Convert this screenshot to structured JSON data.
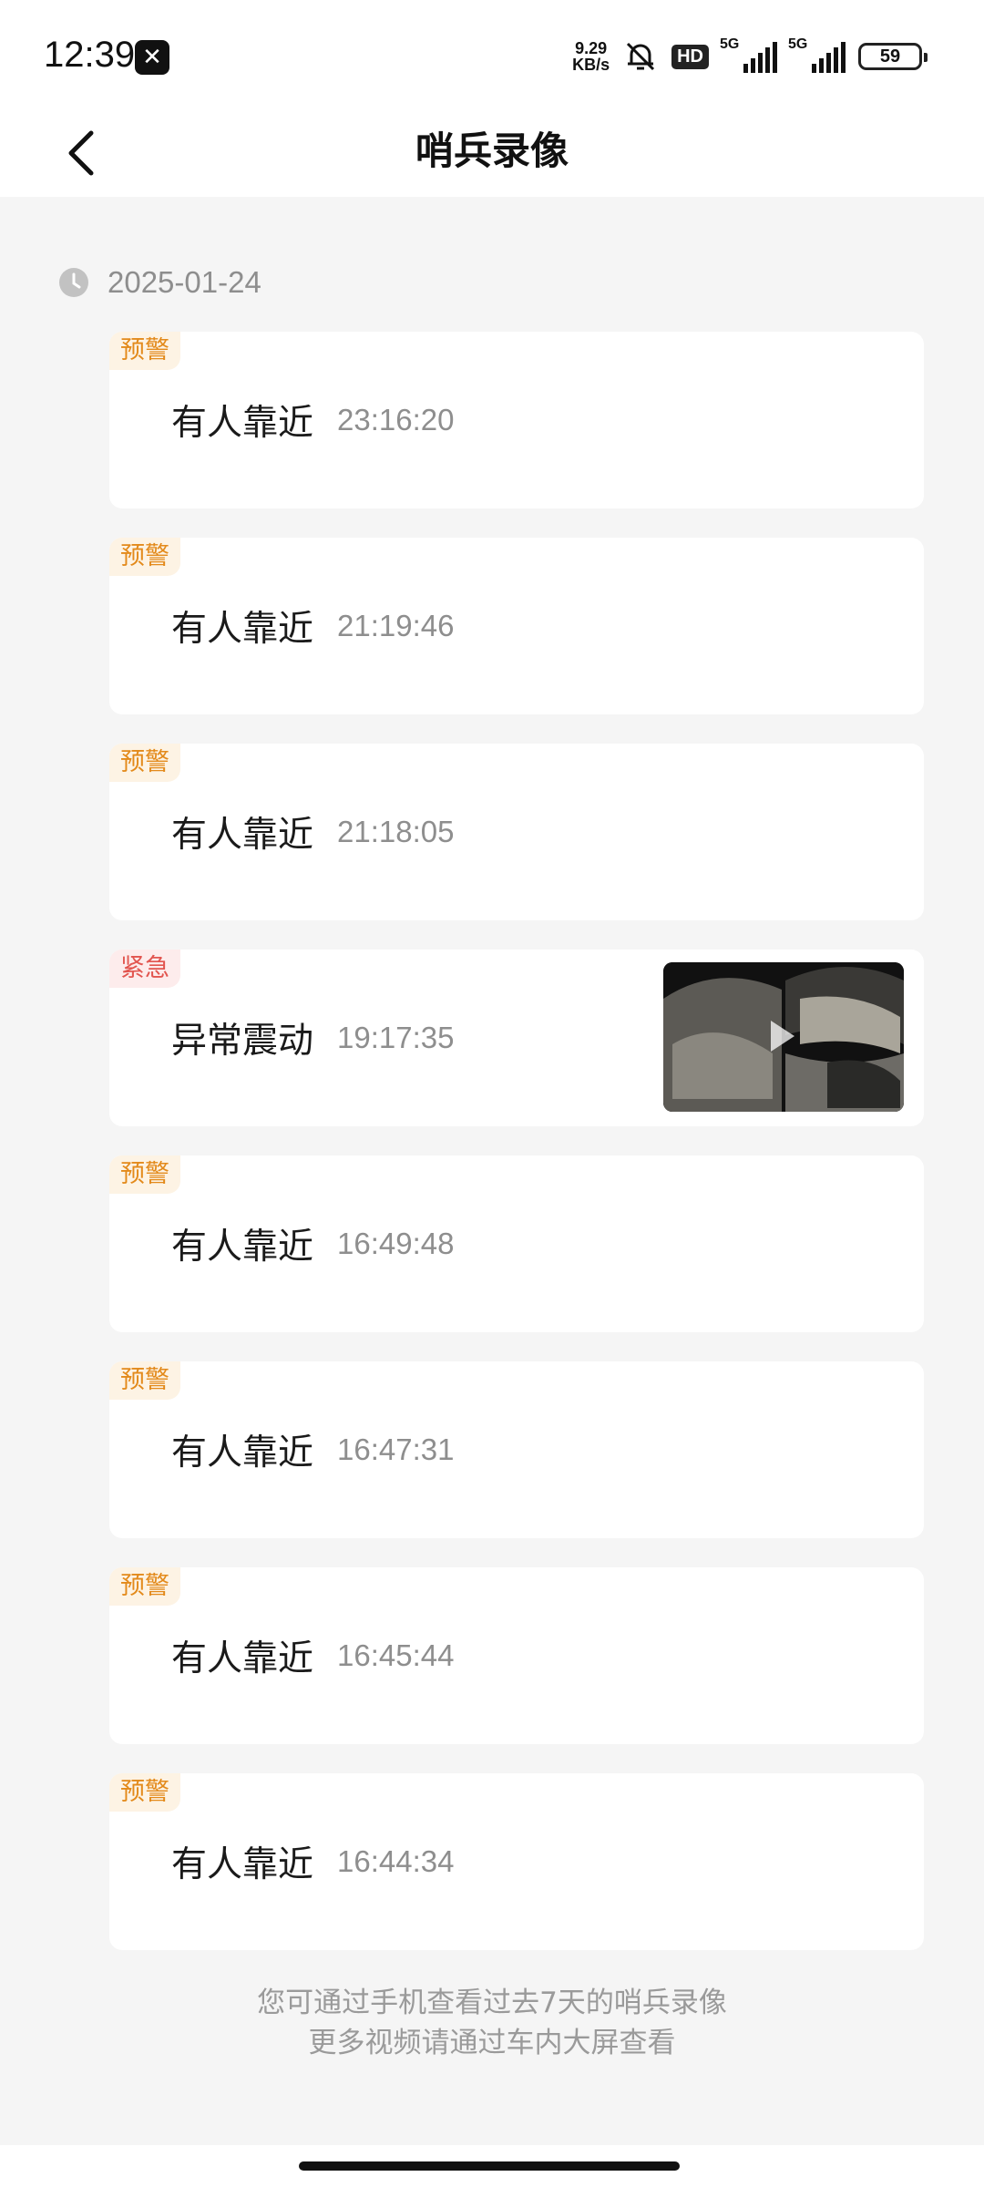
{
  "status_bar": {
    "time": "12:39",
    "net_speed_value": "9.29",
    "net_speed_unit": "KB/s",
    "hd_label": "HD",
    "sim1_label": "5G",
    "sim2_label": "5G",
    "battery": "59"
  },
  "header": {
    "title": "哨兵录像"
  },
  "date_group": {
    "date": "2025-01-24"
  },
  "events": [
    {
      "badge": "预警",
      "level": "warn",
      "name": "有人靠近",
      "time": "23:16:20",
      "has_thumbnail": false
    },
    {
      "badge": "预警",
      "level": "warn",
      "name": "有人靠近",
      "time": "21:19:46",
      "has_thumbnail": false
    },
    {
      "badge": "预警",
      "level": "warn",
      "name": "有人靠近",
      "time": "21:18:05",
      "has_thumbnail": false
    },
    {
      "badge": "紧急",
      "level": "urgent",
      "name": "异常震动",
      "time": "19:17:35",
      "has_thumbnail": true
    },
    {
      "badge": "预警",
      "level": "warn",
      "name": "有人靠近",
      "time": "16:49:48",
      "has_thumbnail": false
    },
    {
      "badge": "预警",
      "level": "warn",
      "name": "有人靠近",
      "time": "16:47:31",
      "has_thumbnail": false
    },
    {
      "badge": "预警",
      "level": "warn",
      "name": "有人靠近",
      "time": "16:45:44",
      "has_thumbnail": false
    },
    {
      "badge": "预警",
      "level": "warn",
      "name": "有人靠近",
      "time": "16:44:34",
      "has_thumbnail": false
    }
  ],
  "footer": {
    "line1": "您可通过手机查看过去7天的哨兵录像",
    "line2": "更多视频请通过车内大屏查看"
  },
  "colors": {
    "background": "#f5f5f5",
    "card": "#ffffff",
    "warn_text": "#e38a1b",
    "warn_bg": "#fdf3e4",
    "urgent_text": "#e2554f",
    "urgent_bg": "#fdecec",
    "secondary_text": "#8e8e8e"
  }
}
